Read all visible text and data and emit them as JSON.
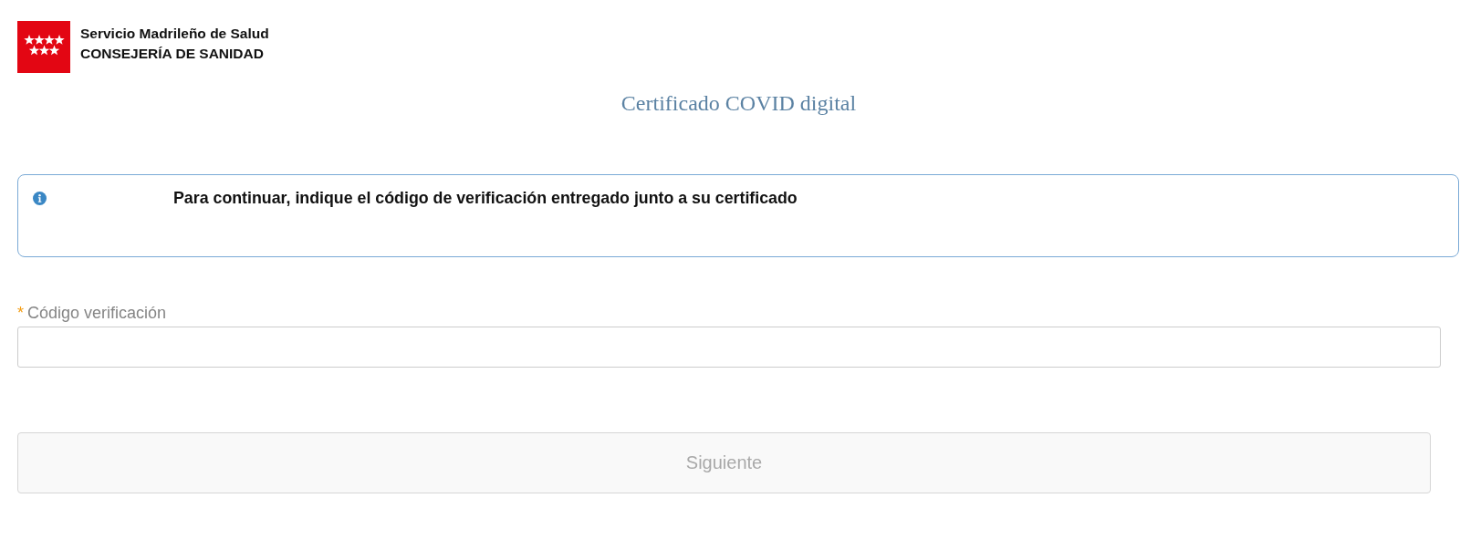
{
  "header": {
    "organization": "Servicio Madrileño de Salud",
    "department": "CONSEJERÍA DE SANIDAD"
  },
  "title": "Certificado COVID digital",
  "notice": {
    "kind": "info",
    "text": "Para continuar, indique el código de verificación entregado junto a su certificado"
  },
  "field": {
    "label": "Código verificación",
    "required": true,
    "required_mark": "*"
  },
  "button": {
    "label": "Siguiente",
    "disabled": true
  }
}
